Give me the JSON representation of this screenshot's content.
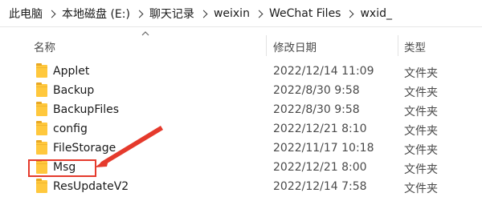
{
  "breadcrumb": [
    {
      "label": "此电脑"
    },
    {
      "label": "本地磁盘 (E:)"
    },
    {
      "label": "聊天记录"
    },
    {
      "label": "weixin"
    },
    {
      "label": "WeChat Files"
    },
    {
      "label": "wxid_"
    }
  ],
  "columns": {
    "name": "名称",
    "date": "修改日期",
    "type": "类型"
  },
  "files": [
    {
      "name": "Applet",
      "date": "2022/12/14 11:09",
      "type": "文件夹"
    },
    {
      "name": "Backup",
      "date": "2022/8/30 9:58",
      "type": "文件夹"
    },
    {
      "name": "BackupFiles",
      "date": "2022/8/30 9:58",
      "type": "文件夹"
    },
    {
      "name": "config",
      "date": "2022/12/21 8:10",
      "type": "文件夹"
    },
    {
      "name": "FileStorage",
      "date": "2022/11/17 10:18",
      "type": "文件夹"
    },
    {
      "name": "Msg",
      "date": "2022/12/21 8:00",
      "type": "文件夹"
    },
    {
      "name": "ResUpdateV2",
      "date": "2022/12/14 7:58",
      "type": "文件夹"
    }
  ],
  "icons": {
    "folder": "folder-icon",
    "sort": "sort-up-icon",
    "separator": "chevron-right-icon"
  },
  "colors": {
    "folder": "#ffc83d",
    "annotation": "#e53a2c"
  },
  "annotation": {
    "highlighted_item": "Msg"
  }
}
